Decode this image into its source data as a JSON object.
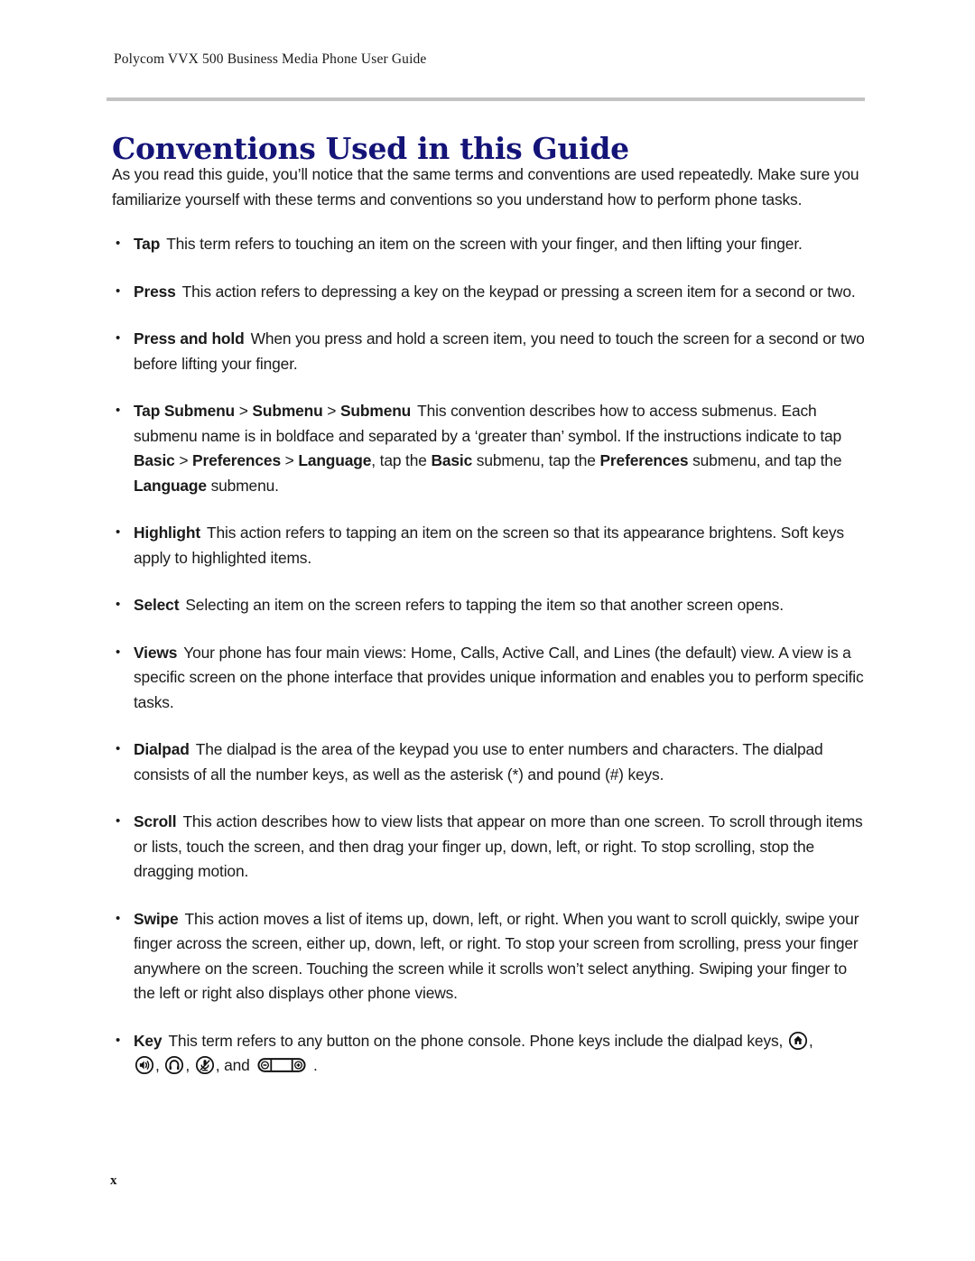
{
  "header": {
    "running_title": "Polycom VVX 500 Business Media Phone User Guide"
  },
  "chapter": {
    "title": "Conventions Used in this Guide"
  },
  "intro": {
    "paragraph": "As you read this guide, you’ll notice that the same terms and conventions are used repeatedly. Make sure you familiarize yourself with these terms and conventions so you understand how to perform phone tasks."
  },
  "bullets": [
    {
      "term": "Tap",
      "text": "This term refers to touching an item on the screen with your finger, and then lifting your finger."
    },
    {
      "term": "Press",
      "text": "This action refers to depressing a key on the keypad or pressing a screen item for a second or two."
    },
    {
      "term": "Press and hold",
      "text": "When you press and hold a screen item, you need to touch the screen for a second or two before lifting your finger."
    },
    {
      "term_part_1": "Tap Submenu",
      "sep_1": " > ",
      "term_part_2": "Submenu",
      "sep_2": " > ",
      "term_part_3": "Submenu",
      "text_1": "This convention describes how to access submenus. Each submenu name is in boldface and separated by a ‘greater than’ symbol. If the instructions indicate to tap ",
      "bold_basic_1": "Basic",
      "sep_3": " > ",
      "bold_preferences_1": "Preferences",
      "sep_4": " > ",
      "bold_language_1": "Language",
      "text_2": ", tap the ",
      "bold_basic_2": "Basic",
      "text_3": " submenu, tap the ",
      "bold_preferences_2": "Preferences",
      "text_4": " submenu, and tap the ",
      "bold_language_2": "Language",
      "text_5": " submenu."
    },
    {
      "term": "Highlight",
      "text": "This action refers to tapping an item on the screen so that its appearance brightens. Soft keys apply to highlighted items."
    },
    {
      "term": "Select",
      "text": "Selecting an item on the screen refers to tapping the item so that another screen opens."
    },
    {
      "term": "Views",
      "text": "Your phone has four main views: Home, Calls, Active Call, and Lines (the default) view. A view is a specific screen on the phone interface that provides unique information and enables you to perform specific tasks."
    },
    {
      "term": "Dialpad",
      "text": "The dialpad is the area of the keypad you use to enter numbers and characters. The dialpad consists of all the number keys, as well as the asterisk (*) and pound (#) keys."
    },
    {
      "term": "Scroll",
      "text": "This action describes how to view lists that appear on more than one screen. To scroll through items or lists, touch the screen, and then drag your finger up, down, left, or right. To stop scrolling, stop the dragging motion."
    },
    {
      "term": "Swipe",
      "text": "This action moves a list of items up, down, left, or right. When you want to scroll quickly, swipe your finger across the screen, either up, down, left, or right. To stop your screen from scrolling, press your finger anywhere on the screen. Touching the screen while it scrolls won’t select anything. Swiping your finger to the left or right also displays other phone views."
    }
  ],
  "key_bullet": {
    "term": "Key",
    "text_1": "This term refers to any button on the phone console. Phone keys include the dialpad keys, ",
    "comma_1": ", ",
    "comma_2": ", ",
    "comma_3": ", ",
    "and_text": ", and ",
    "period": " .",
    "icons": [
      "home-key-icon",
      "speaker-key-icon",
      "headset-key-icon",
      "mute-key-icon",
      "volume-key-icon"
    ],
    "volume_minus": "–",
    "volume_plus": "+"
  },
  "footer": {
    "page_number": "x"
  },
  "colors": {
    "heading": "#141478",
    "rule": "#c3c3c3",
    "body_text": "#1a1a1a"
  }
}
